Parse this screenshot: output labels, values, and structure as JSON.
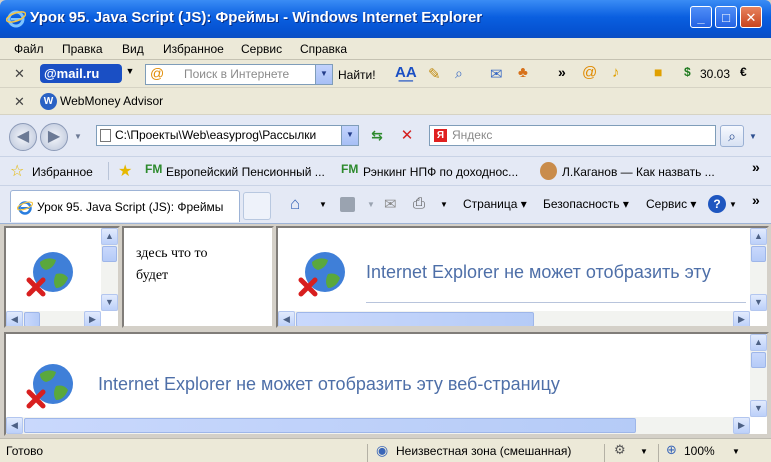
{
  "window": {
    "title": "Урок 95. Java Script (JS): Фреймы - Windows Internet Explorer"
  },
  "menu": [
    "Файл",
    "Правка",
    "Вид",
    "Избранное",
    "Сервис",
    "Справка"
  ],
  "mailbar": {
    "brand": "@mail.ru",
    "search_placeholder": "Поиск в Интернете",
    "find_label": "Найти!",
    "currency": "30.03"
  },
  "webmoney": {
    "label": "WebMoney Advisor"
  },
  "address": {
    "url": "C:\\Проекты\\Web\\easyprog\\Рассылки",
    "search_placeholder": "Яндекс"
  },
  "favorites": {
    "label": "Избранное",
    "links": [
      "Европейский Пенсионный ...",
      "Рэнкинг НПФ по доходнос...",
      "Л.Каганов — Как назвать ..."
    ]
  },
  "tab": {
    "label": "Урок 95. Java Script (JS): Фреймы"
  },
  "commands": {
    "page": "Страница",
    "safety": "Безопасность",
    "service": "Сервис"
  },
  "frames": {
    "middle_text_line1": "здесь что то",
    "middle_text_line2": "будет",
    "error_right": "Internet Explorer не может отобразить эту",
    "error_bottom": "Internet Explorer не может отобразить эту веб-страницу"
  },
  "status": {
    "ready": "Готово",
    "zone": "Неизвестная зона (смешанная)",
    "zoom": "100%"
  },
  "colors": {
    "title_blue": "#0653d2",
    "error_text": "#4e6fa8"
  }
}
